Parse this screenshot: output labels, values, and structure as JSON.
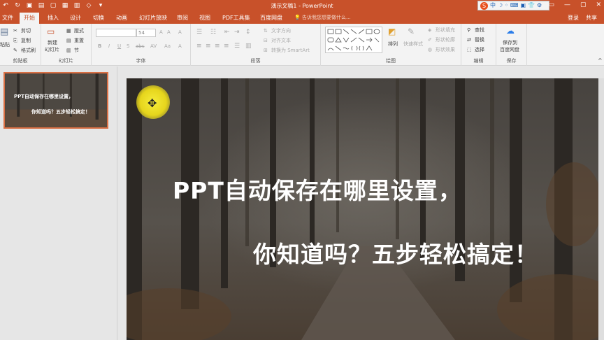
{
  "window": {
    "title": "演示文稿1 - PowerPoint",
    "login": "登录",
    "share": "共享",
    "tray_items": [
      "S",
      "中",
      "☽",
      "◦",
      "⌨",
      "▣",
      "👕",
      "⚙"
    ]
  },
  "tabs": [
    "文件",
    "开始",
    "插入",
    "设计",
    "切换",
    "动画",
    "幻灯片放映",
    "审阅",
    "视图",
    "PDF工具集",
    "百度网盘"
  ],
  "active_tab": "开始",
  "tell_me": "告诉我您想要做什么...",
  "ribbon": {
    "clipboard": {
      "paste": "粘贴",
      "cut": "剪切",
      "copy": "复制",
      "format_painter": "格式刷",
      "label": "剪贴板"
    },
    "slides": {
      "new_slide": "新建",
      "new_slide2": "幻灯片",
      "layout": "版式",
      "reset": "重置",
      "section": "节",
      "label": "幻灯片"
    },
    "font": {
      "font_name": "",
      "font_size": "54",
      "bold": "B",
      "italic": "I",
      "underline": "U",
      "strike": "S",
      "shadow": "abc",
      "spacing": "AV",
      "case": "Aa",
      "color": "A",
      "grow": "A",
      "shrink": "A",
      "clear": "A",
      "label": "字体"
    },
    "paragraph": {
      "text_direction": "文字方向",
      "align_text": "对齐文本",
      "smartart": "转换为 SmartArt",
      "label": "段落"
    },
    "drawing": {
      "arrange": "排列",
      "quick_styles": "快速样式",
      "shape_fill": "形状填充",
      "shape_outline": "形状轮廓",
      "shape_effects": "形状效果",
      "label": "绘图"
    },
    "editing": {
      "find": "查找",
      "replace": "替换",
      "select": "选择",
      "label": "编辑"
    },
    "save": {
      "save_to": "保存到",
      "baidu": "百度网盘",
      "label": "保存"
    }
  },
  "slides_pane": {
    "thumbnail_number": "1",
    "thumb_line1": "PPT自动保存在哪里设置，",
    "thumb_line2": "你知道吗？五步轻松搞定！"
  },
  "slide": {
    "line1": "PPT自动保存在哪里设置，",
    "line2": "你知道吗？五步轻松搞定！"
  },
  "colors": {
    "accent": "#c8512a",
    "ribbon_bg": "#f3f3f3",
    "cursor_highlight": "#f0e22a"
  }
}
